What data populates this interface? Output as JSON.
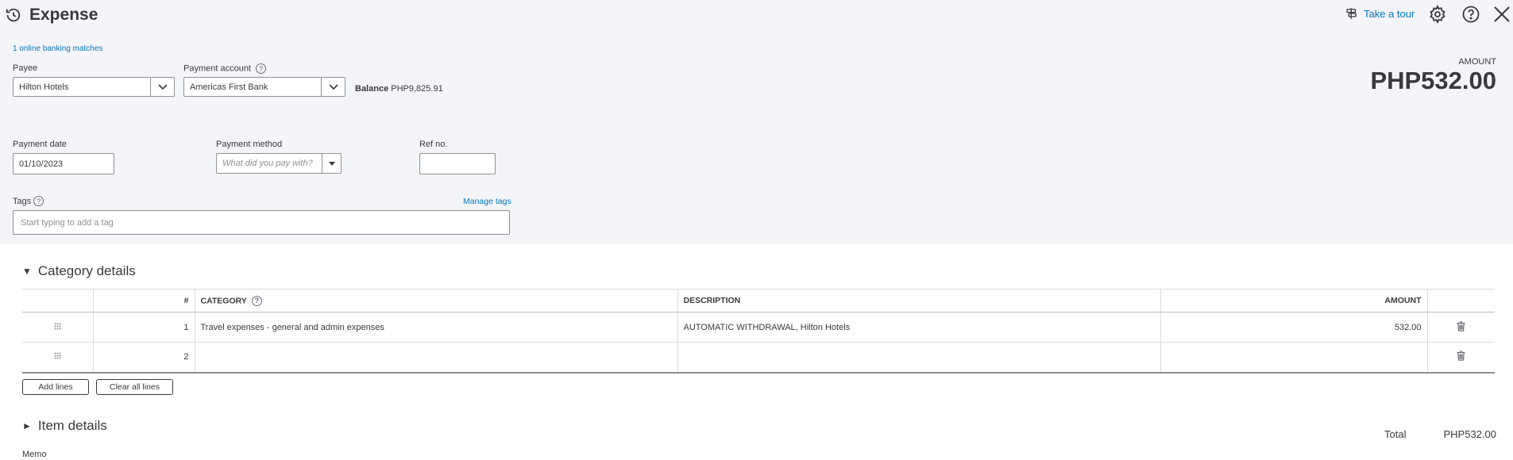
{
  "header": {
    "title": "Expense",
    "take_tour": "Take a tour"
  },
  "banking_link": "1 online banking matches",
  "payee": {
    "label": "Payee",
    "value": "Hilton Hotels"
  },
  "payment_account": {
    "label": "Payment account",
    "value": "Americas First Bank",
    "balance_label": "Balance",
    "balance_value": "PHP9,825.91"
  },
  "amount": {
    "label": "AMOUNT",
    "value": "PHP532.00"
  },
  "payment_date": {
    "label": "Payment date",
    "value": "01/10/2023"
  },
  "payment_method": {
    "label": "Payment method",
    "placeholder": "What did you pay with?"
  },
  "ref_no": {
    "label": "Ref no.",
    "value": ""
  },
  "tags": {
    "label": "Tags",
    "manage": "Manage tags",
    "placeholder": "Start typing to add a tag"
  },
  "category_details": {
    "title": "Category details",
    "columns": {
      "num": "#",
      "category": "CATEGORY",
      "description": "DESCRIPTION",
      "amount": "AMOUNT"
    },
    "rows": [
      {
        "num": "1",
        "category": "Travel expenses - general and admin expenses",
        "description": "AUTOMATIC WITHDRAWAL, Hilton Hotels",
        "amount": "532.00"
      },
      {
        "num": "2",
        "category": "",
        "description": "",
        "amount": ""
      }
    ],
    "add_lines": "Add lines",
    "clear_lines": "Clear all lines"
  },
  "item_details": {
    "title": "Item details"
  },
  "total": {
    "label": "Total",
    "value": "PHP532.00"
  },
  "memo": {
    "label": "Memo"
  },
  "colors": {
    "link": "#0077c5",
    "top_bg": "#f4f5f8",
    "text": "#393a3d"
  }
}
